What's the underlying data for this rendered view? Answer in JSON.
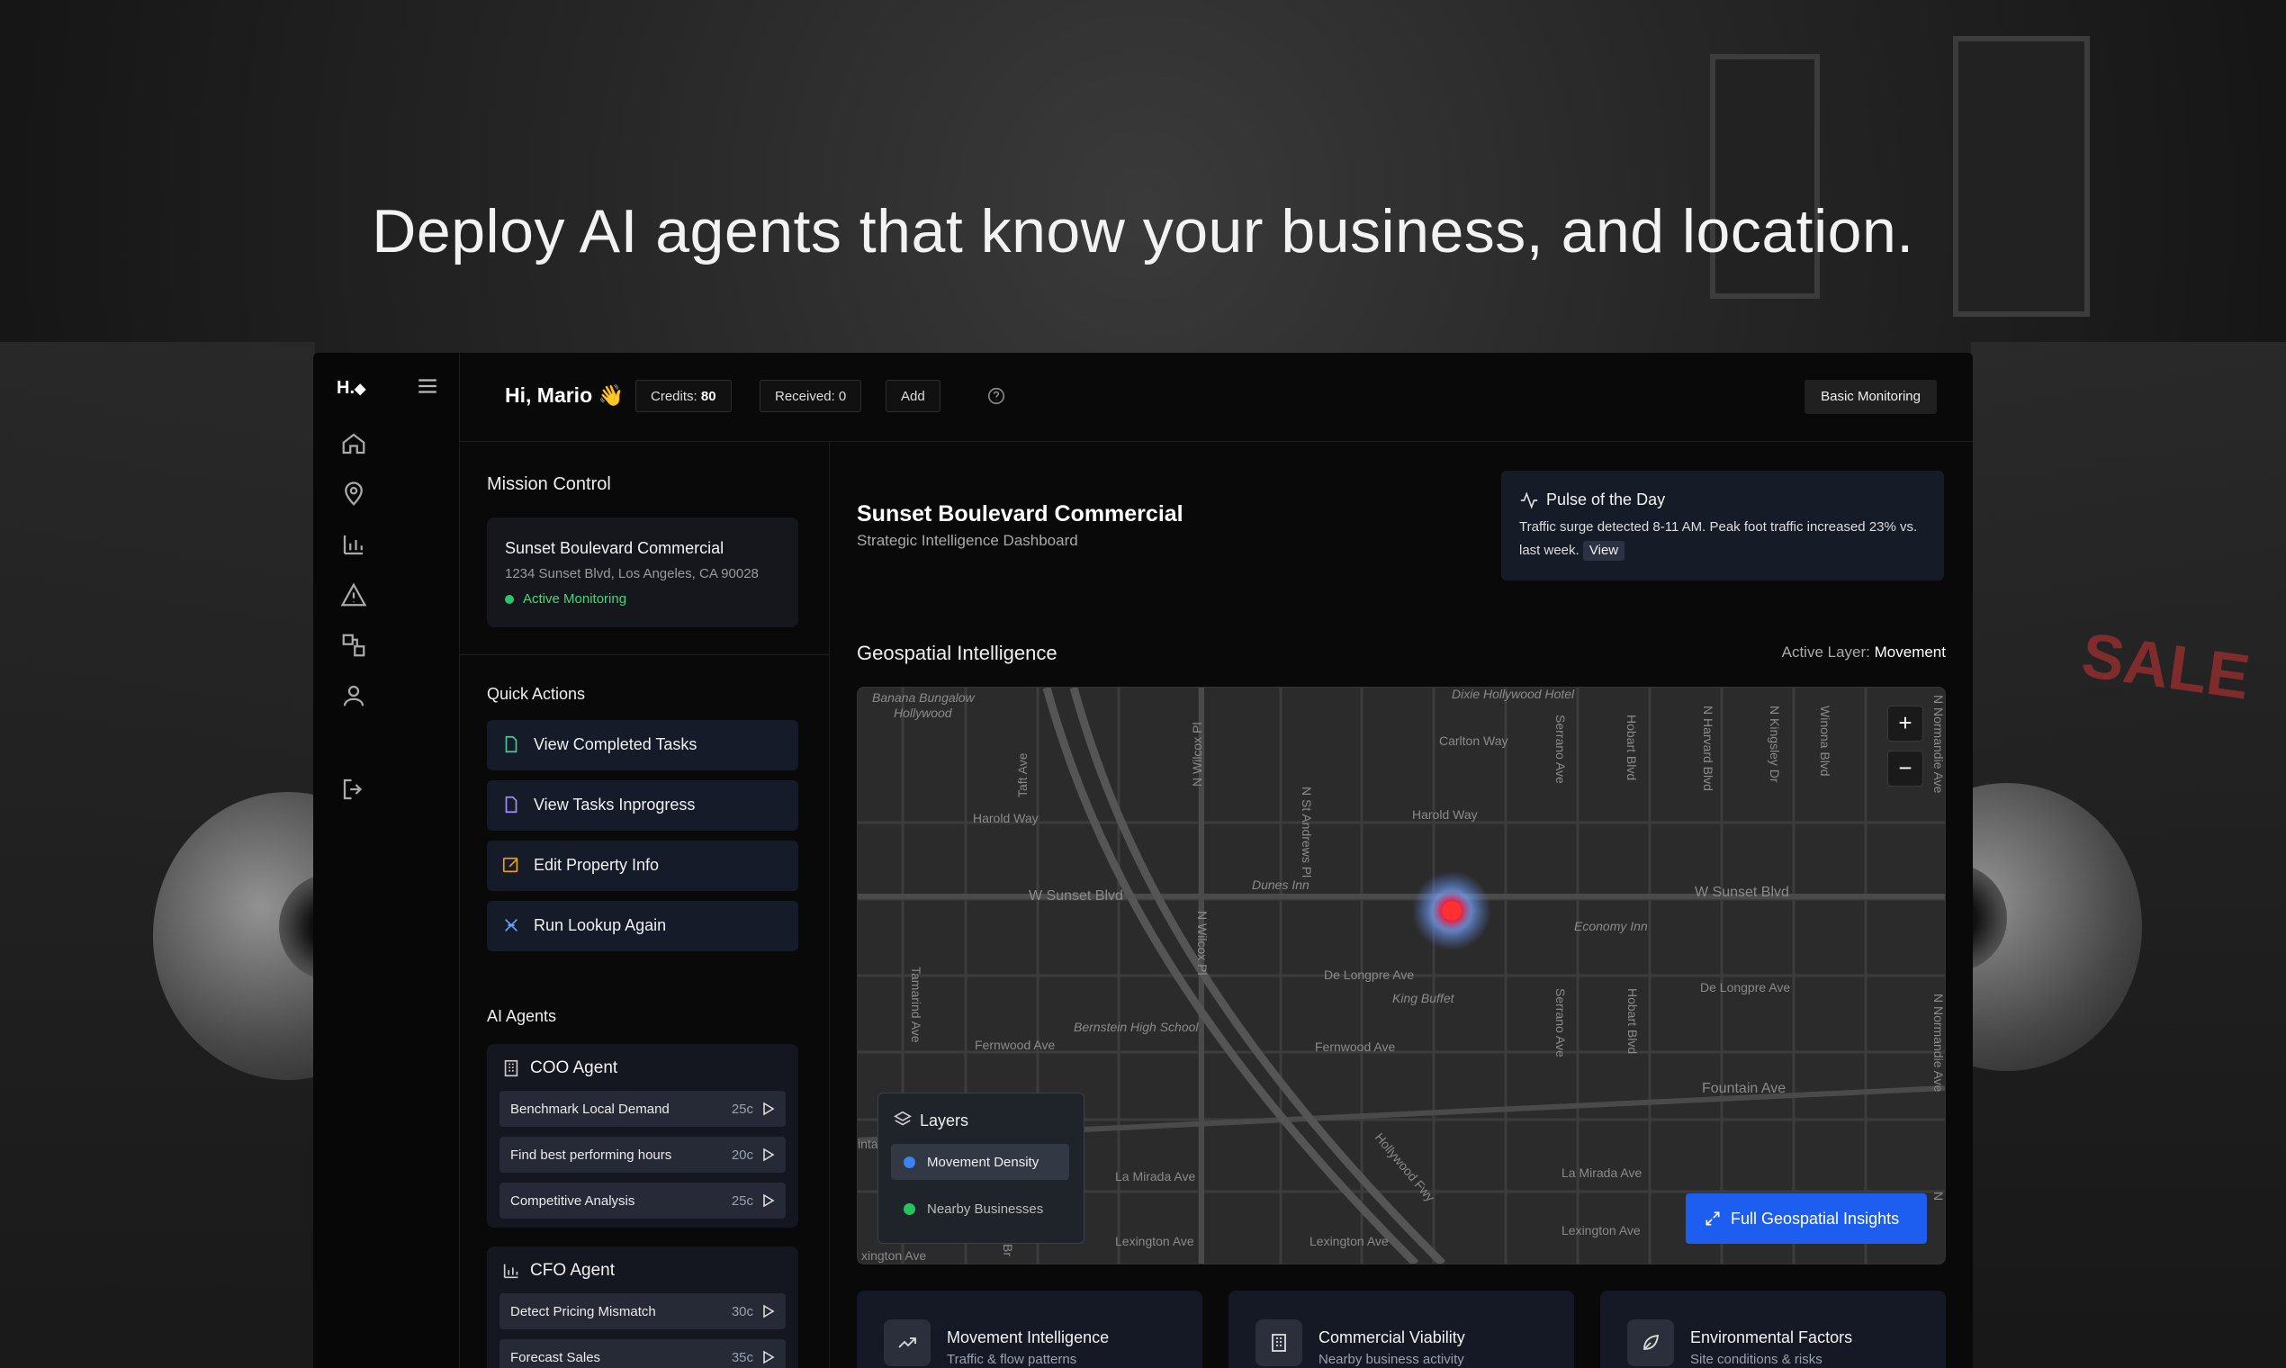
{
  "headline": "Deploy AI agents that know your business, and location.",
  "backdrop": {
    "sale_text": "SALE"
  },
  "sidebar": {
    "brand": "H.",
    "icons": [
      "home-icon",
      "location-pin-icon",
      "bar-chart-icon",
      "alert-triangle-icon",
      "shapes-icon",
      "user-icon",
      "logout-icon"
    ]
  },
  "topbar": {
    "greeting": "Hi, Mario 👋",
    "credits_label": "Credits:",
    "credits_value": "80",
    "received": "Received: 0",
    "add": "Add",
    "plan": "Basic Monitoring"
  },
  "mission": {
    "title": "Mission Control",
    "property_name": "Sunset Boulevard Commercial",
    "address": "1234 Sunset Blvd, Los Angeles, CA 90028",
    "status": "Active Monitoring"
  },
  "quick_actions": {
    "title": "Quick Actions",
    "items": [
      {
        "label": "View Completed Tasks",
        "color": "#3ecf8e"
      },
      {
        "label": "View Tasks Inprogress",
        "color": "#a78bfa"
      },
      {
        "label": "Edit Property Info",
        "color": "#f59e0b"
      },
      {
        "label": "Run Lookup Again",
        "color": "#60a5fa"
      }
    ]
  },
  "agents": {
    "title": "AI Agents",
    "coo": {
      "name": "COO Agent",
      "tasks": [
        {
          "label": "Benchmark Local Demand",
          "cost": "25c"
        },
        {
          "label": "Find best performing hours",
          "cost": "20c"
        },
        {
          "label": "Competitive Analysis",
          "cost": "25c"
        }
      ]
    },
    "cfo": {
      "name": "CFO Agent",
      "tasks": [
        {
          "label": "Detect Pricing Mismatch",
          "cost": "30c"
        },
        {
          "label": "Forecast Sales",
          "cost": "35c"
        }
      ]
    }
  },
  "main": {
    "title": "Sunset Boulevard Commercial",
    "subtitle": "Strategic Intelligence Dashboard",
    "pulse": {
      "title": "Pulse of the Day",
      "body": "Traffic surge detected 8-11 AM. Peak foot traffic increased 23% vs. last week.",
      "view": "View"
    },
    "geo_title": "Geospatial Intelligence",
    "active_layer_label": "Active Layer:",
    "active_layer_value": "Movement"
  },
  "map": {
    "labels": {
      "banana": "Banana Bungalow",
      "hollywood": "Hollywood",
      "taft": "Taft Ave",
      "wilcox_top": "N Wilcox Pl",
      "st_andrews": "N St Andrews Pl",
      "dixie": "Dixie Hollywood Hotel",
      "carlton": "Carlton Way",
      "serrano_top": "Serrano Ave",
      "hobart_top": "Hobart Blvd",
      "harvard": "N Harvard Blvd",
      "kingsley": "N Kingsley Dr",
      "winona": "Winona Blvd",
      "normandie_top": "N Normandie Ave",
      "harold_left": "Harold Way",
      "harold_right": "Harold Way",
      "sunset_left": "W Sunset Blvd",
      "sunset_right": "W Sunset Blvd",
      "dunes": "Dunes Inn",
      "economy": "Economy Inn",
      "wilcox_mid": "N Wilcox Pl",
      "tamarind": "Tamarind Ave",
      "delongpre_mid": "De Longpre Ave",
      "delongpre_right": "De Longpre Ave",
      "king_buffet": "King Buffet",
      "serrano_mid": "Serrano Ave",
      "hobart_mid": "Hobart Blvd",
      "normandie_mid": "N Normandie Ave",
      "bernstein": "Bernstein High School",
      "fernwood_left": "Fernwood Ave",
      "fernwood_mid": "Fernwood Ave",
      "fountain": "Fountain Ave",
      "hollywood_fwy": "Hollywood Fwy",
      "la_mirada_left": "La Mirada Ave",
      "la_mirada_right": "La Mirada Ave",
      "lexington_left": "Lexington Ave",
      "lexington_mid": "Lexington Ave",
      "lexington_right": "Lexington Ave",
      "lexington_edge": "xington Ave",
      "edge_int": "inta",
      "edge_br": "Br",
      "edge_n": "N"
    },
    "layers_title": "Layers",
    "layer_options": [
      {
        "label": "Movement Density",
        "color": "#3b82f6",
        "active": true
      },
      {
        "label": "Nearby Businesses",
        "color": "#22c55e",
        "active": false
      }
    ],
    "zoom_in": "+",
    "zoom_out": "−",
    "cta": "Full Geospatial Insights"
  },
  "bottom_cards": [
    {
      "title": "Movement Intelligence",
      "subtitle": "Traffic & flow patterns",
      "icon": "trend-up-icon"
    },
    {
      "title": "Commercial Viability",
      "subtitle": "Nearby business activity",
      "icon": "building-icon"
    },
    {
      "title": "Environmental Factors",
      "subtitle": "Site conditions & risks",
      "icon": "leaf-icon"
    }
  ]
}
